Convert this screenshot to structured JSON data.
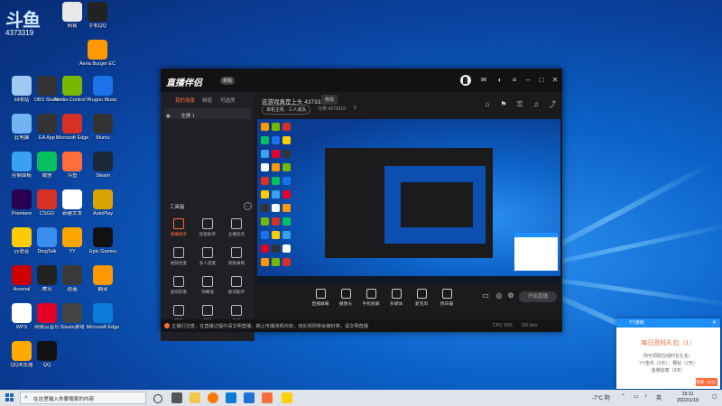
{
  "desktop": {
    "brand_big": "斗鱼",
    "brand_sub": "4373319",
    "icons": [
      {
        "label": "网易",
        "color": "#e8e8e8"
      },
      {
        "label": "手机QQ",
        "color": "#222222"
      },
      {
        "label": "Aeria Burger ECS...",
        "color": "#ff9900"
      },
      {
        "label": "回收站",
        "color": "#9fc9f0"
      },
      {
        "label": "OBS Studio",
        "color": "#333333"
      },
      {
        "label": "Nvidia Control Panel",
        "color": "#76b900"
      },
      {
        "label": "Kugou Music",
        "color": "#1a73e8"
      },
      {
        "label": "此电脑",
        "color": "#6fb3f0"
      },
      {
        "label": "EA App",
        "color": "#333333"
      },
      {
        "label": "Microsoft Edge",
        "color": "#d93025"
      },
      {
        "label": "Mumu",
        "color": "#333333"
      },
      {
        "label": "控制面板",
        "color": "#3aa0f0"
      },
      {
        "label": "微信",
        "color": "#07c160"
      },
      {
        "label": "斗鱼",
        "color": "#ff6d3b"
      },
      {
        "label": "Steam",
        "color": "#1b2838"
      },
      {
        "label": "Premiere",
        "color": "#2a0050"
      },
      {
        "label": "CSGO",
        "color": "#d93025"
      },
      {
        "label": "新建文本",
        "color": "#ffffff"
      },
      {
        "label": "AutoPlay",
        "color": "#d9a400"
      },
      {
        "label": "yy语音",
        "color": "#ffcc00"
      },
      {
        "label": "DingTalk",
        "color": "#3a8ef0"
      },
      {
        "label": "YY",
        "color": "#ffa500"
      },
      {
        "label": "Epic Games",
        "color": "#111111"
      },
      {
        "label": "Arsenal",
        "color": "#cc0000"
      },
      {
        "label": "腾讯",
        "color": "#222222"
      },
      {
        "label": "逍遥",
        "color": "#3a3a3a"
      },
      {
        "label": "翻译",
        "color": "#ff9900"
      },
      {
        "label": "WPS",
        "color": "#ffffff"
      },
      {
        "label": "网易云音乐",
        "color": "#e60026"
      },
      {
        "label": "Steam游戏",
        "color": "#444444"
      },
      {
        "label": "Microsoft Edge",
        "color": "#0a7cd8"
      },
      {
        "label": "QQ浏览器",
        "color": "#ffaa00"
      },
      {
        "label": "QQ",
        "color": "#111111"
      }
    ]
  },
  "app": {
    "logo": "直播伴侣",
    "version_badge": "新版",
    "left_tabs": [
      "我的场景",
      "频道",
      "可送房"
    ],
    "scene_label": "全屏 1",
    "tools_title": "工具箱",
    "tools": [
      {
        "label": "弹幕助手",
        "active": true
      },
      {
        "label": "房管助手"
      },
      {
        "label": "主播任务"
      },
      {
        "label": "视频连麦"
      },
      {
        "label": "多人连麦"
      },
      {
        "label": "视频录制"
      },
      {
        "label": "虚拟形象"
      },
      {
        "label": "弹幕墙"
      },
      {
        "label": "歌词助手"
      },
      {
        "label": "美颜"
      },
      {
        "label": "截屏"
      },
      {
        "label": "更多"
      }
    ],
    "room_title": "这游戏真是上头 4373319",
    "room_tag": "修改",
    "category_pill": "单机主机 · 三人成队",
    "sub_info": [
      "分类 4373319",
      "0"
    ],
    "bottom_tools": [
      "直播屏幕",
      "摄像头",
      "手机投屏",
      "多媒体",
      "麦克风",
      "扬声器"
    ],
    "live_button": "开始直播",
    "status_text": "主播们注意，在直播过程中请文明直播，禁止传播违规内容，违反规则将会被封禁，请文明直播",
    "status_right": [
      "CPU 10%",
      "0/0 kb/s"
    ]
  },
  "toast": {
    "app_name": "YY游戏",
    "title": "每日登陆礼包（1）",
    "lines": [
      "你可领取在线时长礼包：",
      "YY金币（3天）、赛钻（2天）",
      "金牌勋章（3天）"
    ],
    "button": "领取（3/3）"
  },
  "taskbar": {
    "search_placeholder": "在这里输入你要搜索的内容",
    "weather": "-7°C 阴",
    "lang": "英",
    "time": "15:11",
    "date": "2022/1/19"
  }
}
